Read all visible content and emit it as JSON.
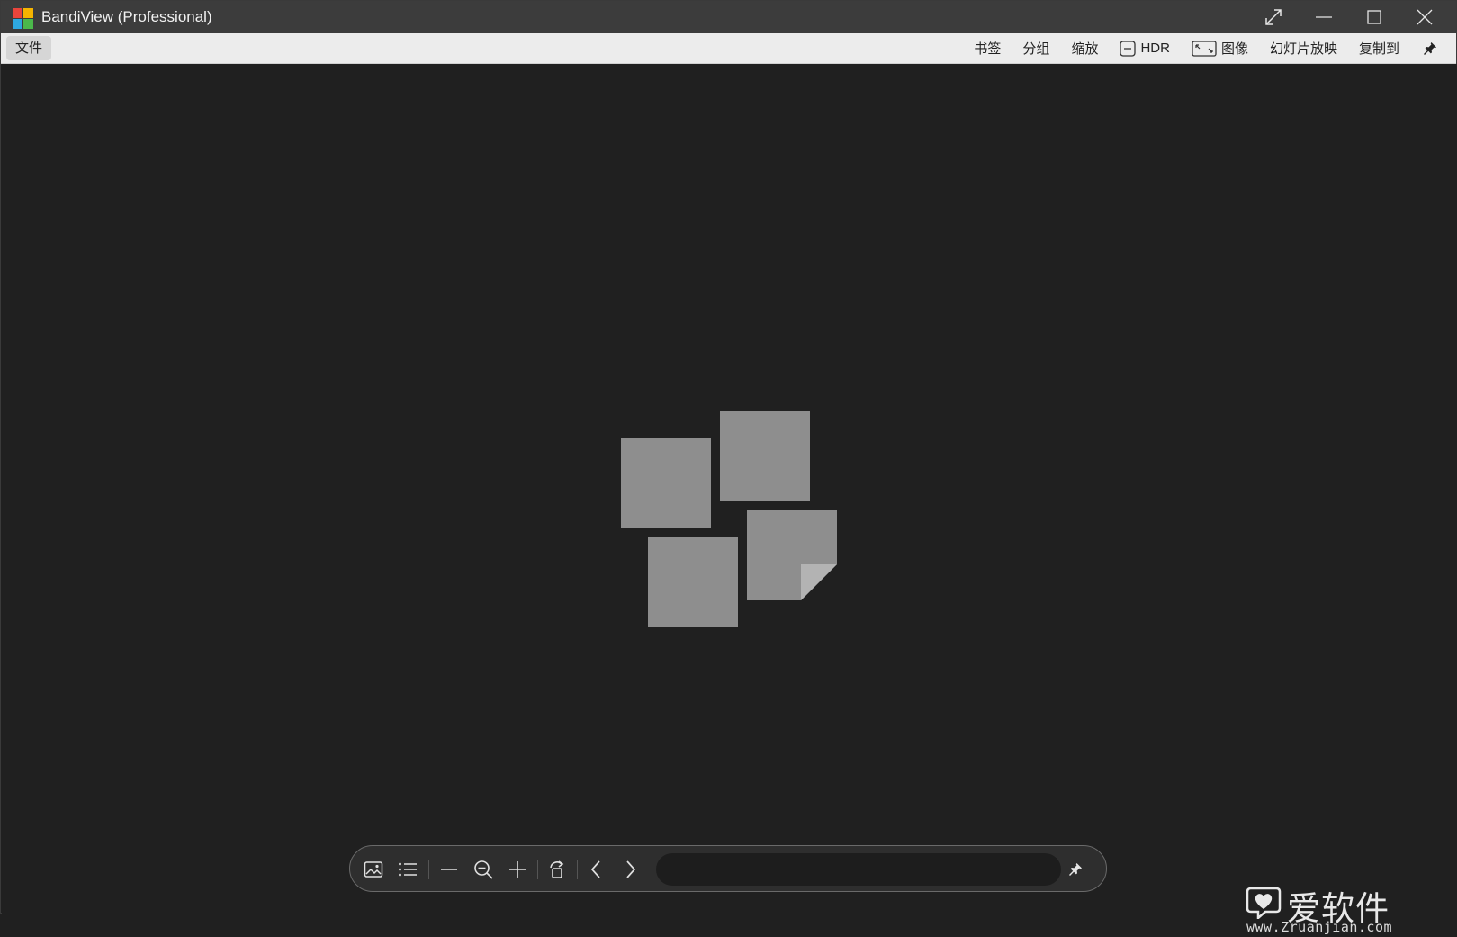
{
  "window": {
    "title": "BandiView (Professional)"
  },
  "menu": {
    "file": "文件",
    "items": [
      {
        "label": "书签"
      },
      {
        "label": "分组"
      },
      {
        "label": "缩放"
      },
      {
        "label": "HDR",
        "icon": "hdr-toggle-icon"
      },
      {
        "label": "图像",
        "icon": "fit-image-icon"
      },
      {
        "label": "幻灯片放映"
      },
      {
        "label": "复制到"
      }
    ]
  },
  "toolbar": {
    "buttons": [
      "image-icon",
      "list-icon",
      "zoom-out-minus-icon",
      "zoom-icon",
      "zoom-in-plus-icon",
      "rotate-icon",
      "previous-icon",
      "next-icon",
      "pin-icon"
    ],
    "path_value": ""
  },
  "watermark": {
    "text": "爱软件",
    "url": "www.Zruanjian.com"
  },
  "colors": {
    "titlebar": "#3c3c3c",
    "menubar": "#ececec",
    "background": "#202020",
    "placeholder": "#8e8e8e"
  }
}
